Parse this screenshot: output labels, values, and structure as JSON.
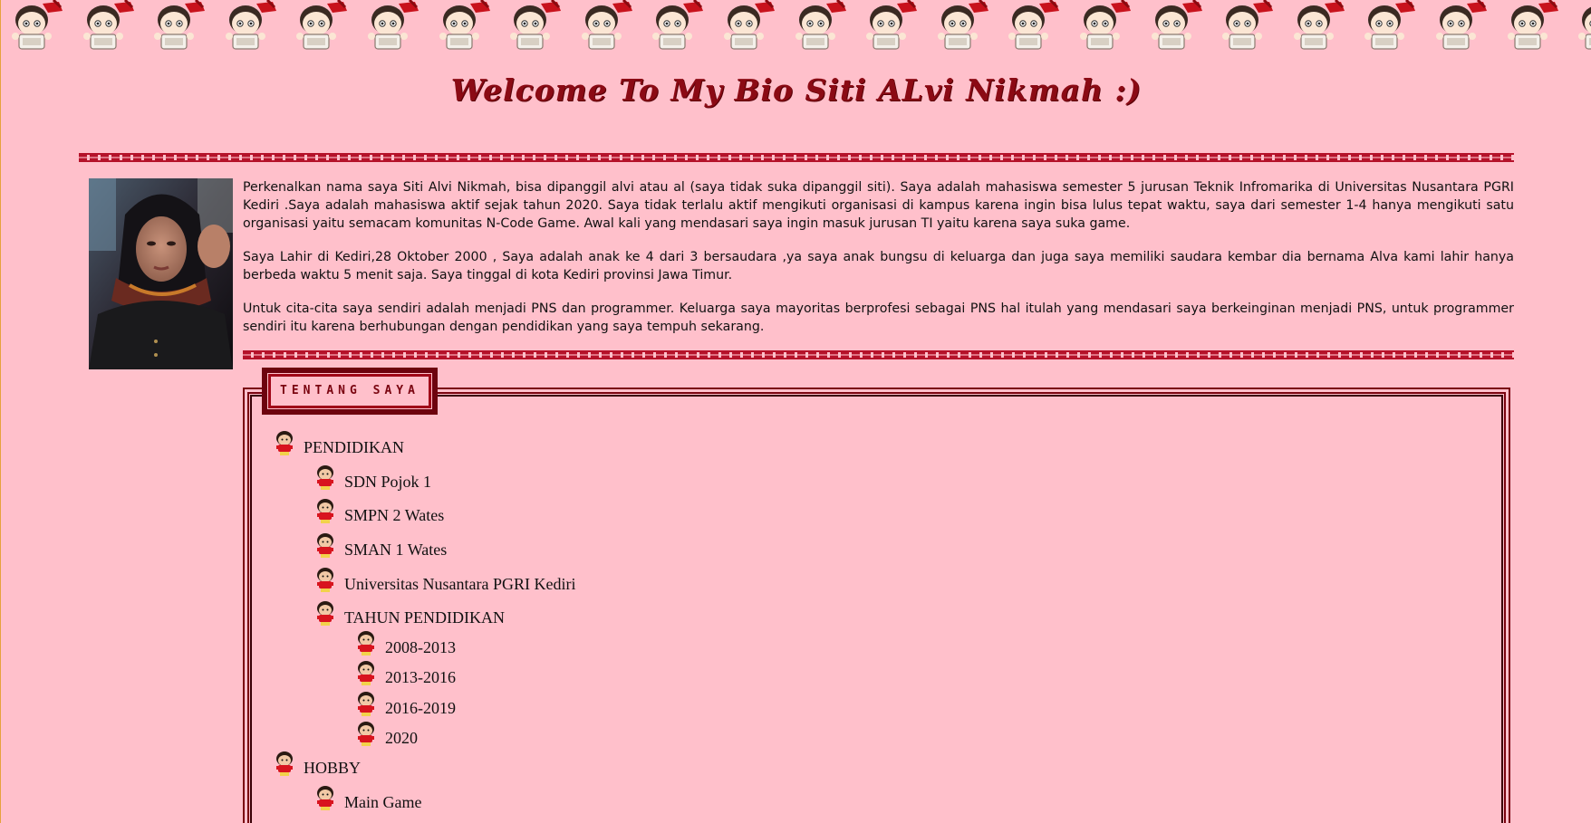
{
  "page": {
    "title": "Welcome To My Bio Siti ALvi Nikmah :)"
  },
  "intro": {
    "paragraphs": [
      "Perkenalkan nama saya Siti Alvi Nikmah, bisa dipanggil alvi atau al (saya tidak suka dipanggil siti). Saya adalah mahasiswa semester 5 jurusan Teknik Infromarika di Universitas Nusantara PGRI Kediri .Saya adalah mahasiswa aktif sejak tahun 2020. Saya tidak terlalu aktif mengikuti organisasi di kampus karena ingin bisa lulus tepat waktu, saya dari semester 1-4 hanya mengikuti satu organisasi yaitu semacam komunitas N-Code Game. Awal kali yang mendasari saya ingin masuk jurusan TI yaitu karena saya suka game.",
      "Saya Lahir di Kediri,28 Oktober 2000 , Saya adalah anak ke 4 dari 3 bersaudara ,ya saya anak bungsu di keluarga dan juga saya memiliki saudara kembar dia bernama Alva kami lahir hanya berbeda waktu 5 menit saja. Saya tinggal di kota Kediri provinsi Jawa Timur.",
      "Untuk cita-cita saya sendiri adalah menjadi PNS dan programmer. Keluarga saya mayoritas berprofesi sebagai PNS hal itulah yang mendasari saya berkeinginan menjadi PNS, untuk programmer sendiri itu karena berhubungan dengan pendidikan yang saya tempuh sekarang."
    ]
  },
  "about": {
    "label": "TENTANG SAYA",
    "items": [
      {
        "text": "PENDIDIKAN"
      },
      {
        "text": "SDN Pojok 1"
      },
      {
        "text": "SMPN 2 Wates"
      },
      {
        "text": "SMAN 1 Wates"
      },
      {
        "text": "Universitas Nusantara PGRI Kediri"
      },
      {
        "text": "TAHUN PENDIDIKAN"
      },
      {
        "text": "2008-2013"
      },
      {
        "text": "2013-2016"
      },
      {
        "text": "2016-2019"
      },
      {
        "text": "2020"
      },
      {
        "text": "HOBBY"
      },
      {
        "text": "Main Game"
      }
    ]
  },
  "colors": {
    "background": "#ffc0cb",
    "accent": "#8b0a14",
    "divider": "#b5122a"
  },
  "icons": {
    "banner": "chibi-girl-icon",
    "bullet": "chibi-boy-icon"
  }
}
